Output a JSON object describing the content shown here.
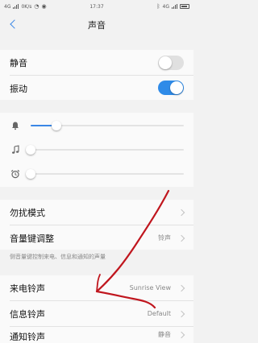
{
  "status_bar": {
    "network": "4G",
    "speed": "0K/s",
    "time": "17:37",
    "network_right": "4G"
  },
  "header": {
    "title": "声音"
  },
  "toggles": [
    {
      "label": "静音",
      "on": false
    },
    {
      "label": "振动",
      "on": true
    }
  ],
  "sliders": [
    {
      "icon": "bell-icon",
      "level": 0.17
    },
    {
      "icon": "music-note-icon",
      "level": 0.0
    },
    {
      "icon": "alarm-clock-icon",
      "level": 0.0
    }
  ],
  "menu": {
    "dnd": {
      "label": "勿扰模式"
    },
    "volume_key": {
      "label": "音量键调整",
      "value": "铃声"
    },
    "volume_key_desc": "侧音量键控制来电、信息和通知的声量",
    "ringtone": {
      "label": "来电铃声",
      "value": "Sunrise View"
    },
    "message_tone": {
      "label": "信息铃声",
      "value": "Default"
    },
    "notification_tone": {
      "label": "通知铃声",
      "value": "静音"
    }
  },
  "colors": {
    "accent": "#3a87e6",
    "annotation": "#c0161e"
  }
}
